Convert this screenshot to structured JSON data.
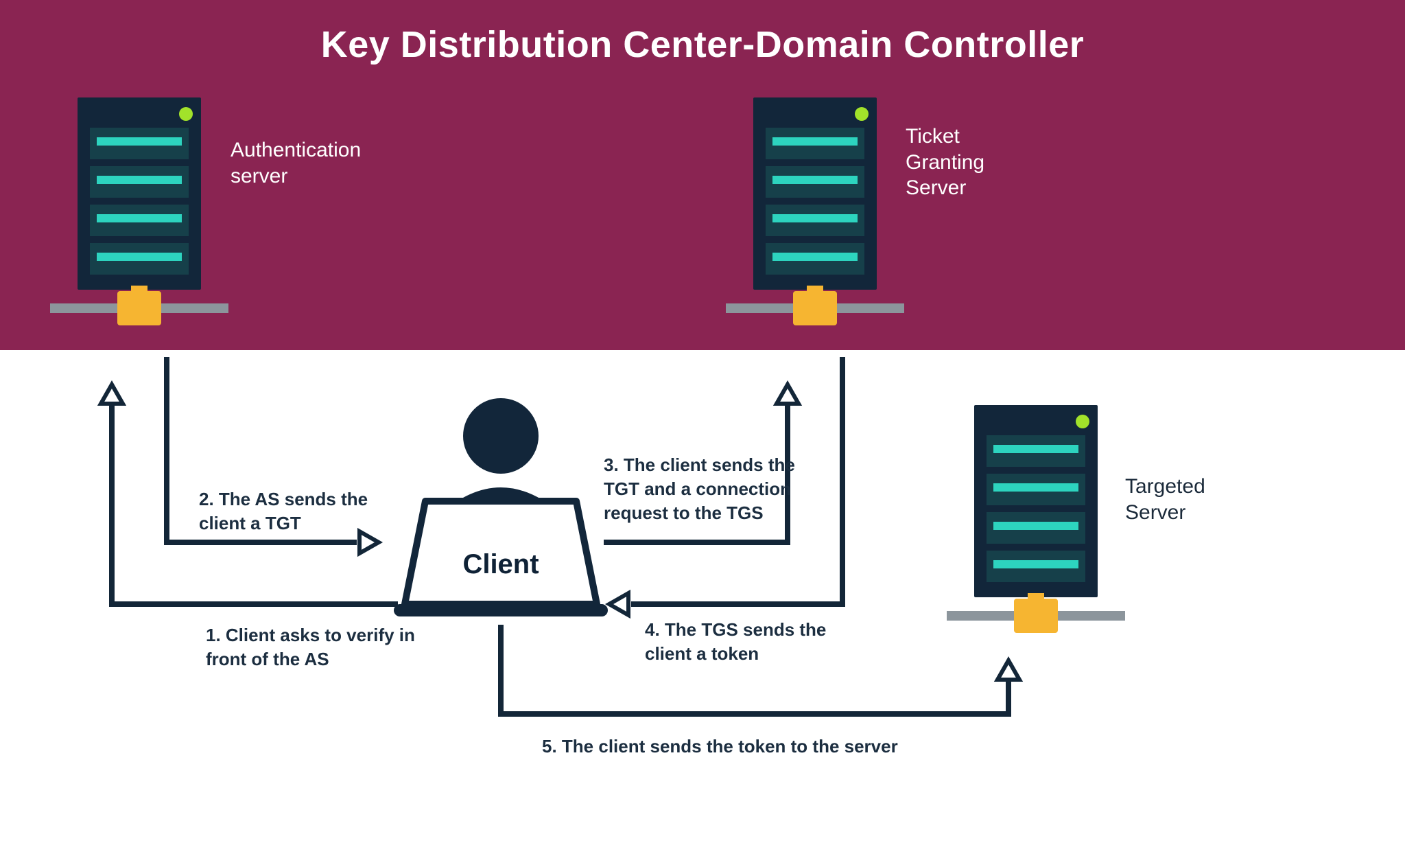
{
  "title": "Key Distribution Center-Domain Controller",
  "nodes": {
    "auth_server": "Authentication server",
    "tgs": "Ticket Granting Server",
    "targeted": "Targeted Server",
    "client": "Client"
  },
  "steps": {
    "s1": "1.  Client asks to verify in front of the AS",
    "s2": "2. The AS sends the client a TGT",
    "s3": "3.  The client sends the TGT and a connection request to the TGS",
    "s4": "4. The TGS sends the client a token",
    "s5": "5. The client sends the token to the server"
  },
  "colors": {
    "band": "#8a2452",
    "navy": "#12263a",
    "teal_dark": "#16404a",
    "teal_light": "#2dd4bf",
    "led": "#a2e22a",
    "line": "#132638",
    "yellow": "#f6b531",
    "grey": "#8c959c"
  }
}
